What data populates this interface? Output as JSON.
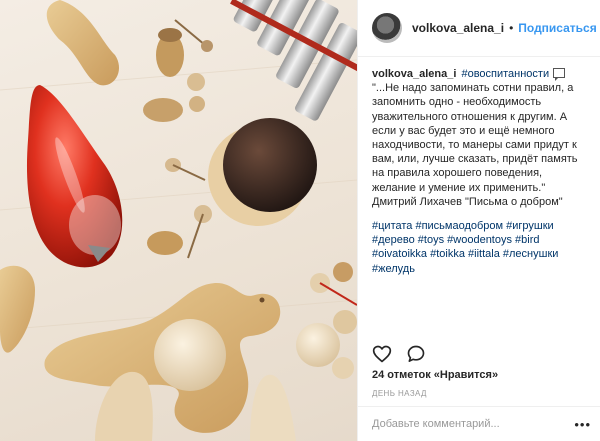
{
  "post": {
    "author": "volkova_alena_i",
    "separator": "•",
    "follow_label": "Подписаться"
  },
  "caption": {
    "username": "volkova_alena_i",
    "hashtag_first": "#овоспитанности",
    "text_main": "\"...Не надо запоминать сотни правил, а запомнить одно - необходимость уважительного отношения к другим. А если у вас будет это и ещё немного находчивости, то манеры сами придут к вам, или, лучше сказать, придёт память на правила хорошего поведения, желание и умение их применить.\" Дмитрий Лихачев \"Письма о добром\"",
    "hashtags": [
      "#цитата",
      "#письмаодобром",
      "#игрушки",
      "#дерево",
      "#toys",
      "#woodentoys",
      "#bird",
      "#oivatoikka",
      "#toikka",
      "#iittala",
      "#леснушки",
      "#желудь"
    ]
  },
  "actions": {
    "like_icon": "heart-icon",
    "comment_icon": "speech-bubble-icon"
  },
  "stats": {
    "likes": "24 отметок «Нравится»",
    "time": "день назад"
  },
  "comment": {
    "placeholder": "Добавьте комментарий...",
    "more": "•••"
  },
  "colors": {
    "link": "#3897f0",
    "hashtag": "#003569",
    "muted": "#999999",
    "text": "#262626",
    "border": "#efefef"
  }
}
